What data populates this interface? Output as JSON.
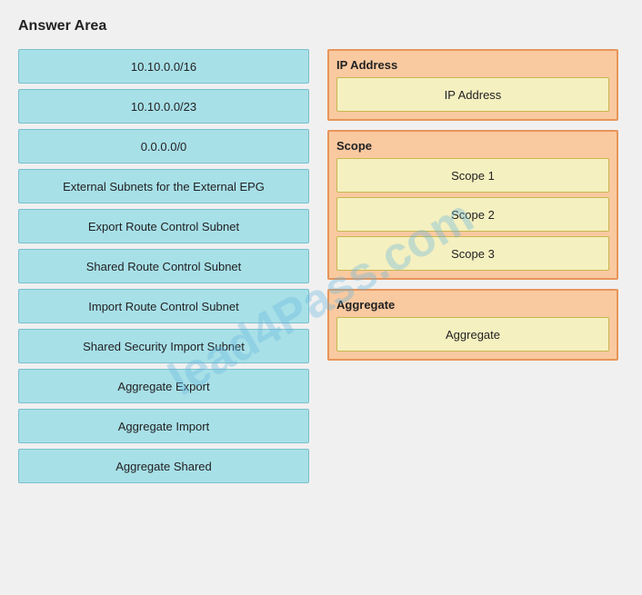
{
  "page": {
    "title": "Answer Area"
  },
  "watermark": "lead4Pass.com",
  "left_items": [
    {
      "id": "item-1",
      "label": "10.10.0.0/16"
    },
    {
      "id": "item-2",
      "label": "10.10.0.0/23"
    },
    {
      "id": "item-3",
      "label": "0.0.0.0/0"
    },
    {
      "id": "item-4",
      "label": "External Subnets for the External EPG"
    },
    {
      "id": "item-5",
      "label": "Export Route Control Subnet"
    },
    {
      "id": "item-6",
      "label": "Shared Route Control Subnet"
    },
    {
      "id": "item-7",
      "label": "Import Route Control Subnet"
    },
    {
      "id": "item-8",
      "label": "Shared Security Import Subnet"
    },
    {
      "id": "item-9",
      "label": "Aggregate Export"
    },
    {
      "id": "item-10",
      "label": "Aggregate Import"
    },
    {
      "id": "item-11",
      "label": "Aggregate Shared"
    }
  ],
  "right_sections": [
    {
      "id": "section-ip",
      "label": "IP Address",
      "items": [
        {
          "id": "drop-ip-1",
          "label": "IP Address"
        }
      ]
    },
    {
      "id": "section-scope",
      "label": "Scope",
      "items": [
        {
          "id": "drop-scope-1",
          "label": "Scope 1"
        },
        {
          "id": "drop-scope-2",
          "label": "Scope 2"
        },
        {
          "id": "drop-scope-3",
          "label": "Scope 3"
        }
      ]
    },
    {
      "id": "section-aggregate",
      "label": "Aggregate",
      "items": [
        {
          "id": "drop-agg-1",
          "label": "Aggregate"
        }
      ]
    }
  ]
}
